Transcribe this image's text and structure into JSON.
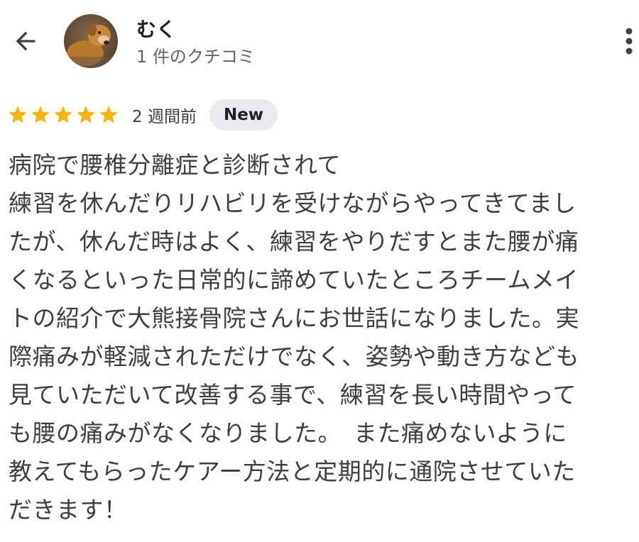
{
  "header": {
    "author_name": "むく",
    "author_meta": "1 件のクチコミ"
  },
  "rating": {
    "stars": 5,
    "max_stars": 5,
    "star_color": "#f4b400",
    "time": "2 週間前",
    "badge": "New"
  },
  "review": {
    "lines": [
      "病院で腰椎分離症と診断されて",
      "練習を休んだりリハビリを受けながらやってきてまし",
      "たが、休んだ時はよく、練習をやりだすとまた腰が痛",
      "くなるといった日常的に諦めていたところチームメイ",
      "トの紹介で大熊接骨院さんにお世話になりました。実",
      "際痛みが軽減されただけでなく、姿勢や動き方なども",
      "見ていただいて改善する事で、練習を長い時間やって",
      "も腰の痛みがなくなりました。　また痛めないように",
      "教えてもらったケアー方法と定期的に通院させていた",
      "だきます！"
    ]
  },
  "icons": {
    "back": "arrow-back-icon",
    "more": "more-vert-icon",
    "star": "star-icon"
  }
}
